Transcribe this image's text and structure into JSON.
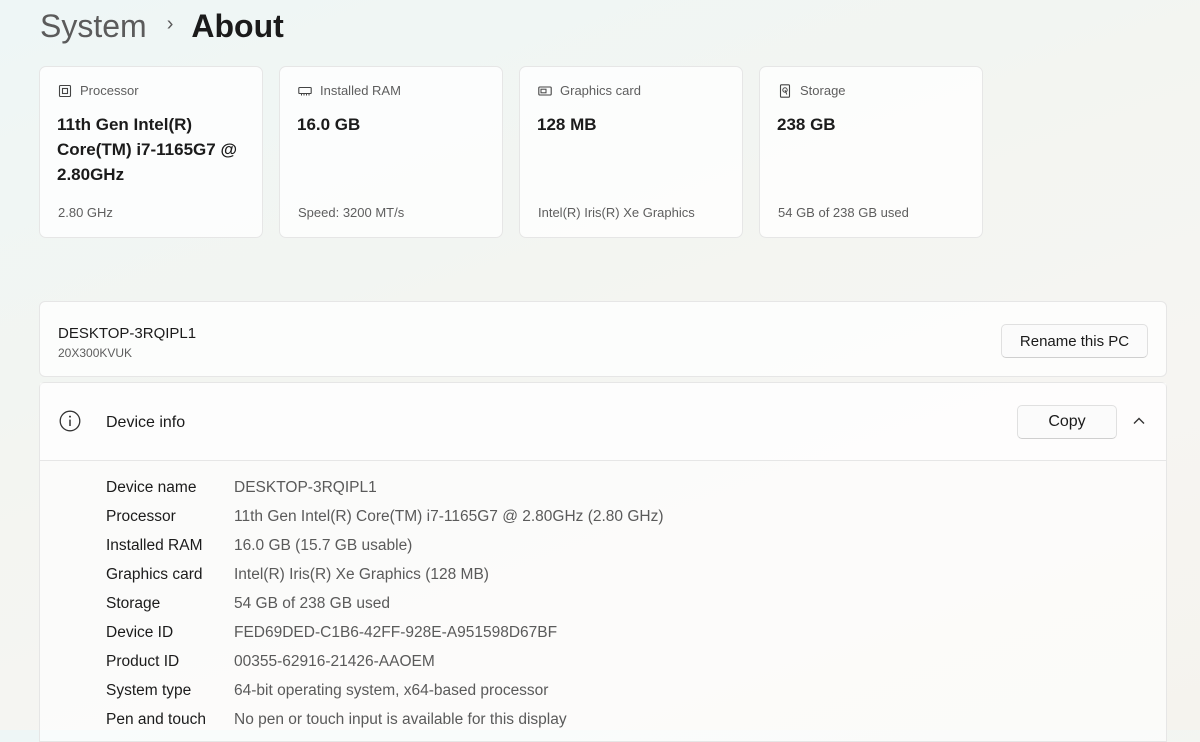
{
  "breadcrumb": {
    "parent": "System",
    "separator": "›",
    "current": "About"
  },
  "spec_cards": [
    {
      "icon": "processor-icon",
      "label": "Processor",
      "value": "11th Gen Intel(R) Core(TM) i7-1165G7 @ 2.80GHz",
      "sub": "2.80 GHz"
    },
    {
      "icon": "ram-icon",
      "label": "Installed RAM",
      "value": "16.0 GB",
      "sub": "Speed: 3200 MT/s"
    },
    {
      "icon": "graphics-card-icon",
      "label": "Graphics card",
      "value": "128 MB",
      "sub": "Intel(R) Iris(R) Xe Graphics"
    },
    {
      "icon": "storage-icon",
      "label": "Storage",
      "value": "238 GB",
      "sub": "54 GB of 238 GB used"
    }
  ],
  "pc": {
    "name": "DESKTOP-3RQIPL1",
    "model": "20X300KVUK",
    "rename_label": "Rename this PC"
  },
  "device_info": {
    "icon": "info-icon",
    "title": "Device info",
    "copy_label": "Copy",
    "rows": [
      {
        "key": "Device name",
        "value": "DESKTOP-3RQIPL1"
      },
      {
        "key": "Processor",
        "value": "11th Gen Intel(R) Core(TM) i7-1165G7 @ 2.80GHz (2.80 GHz)"
      },
      {
        "key": "Installed RAM",
        "value": "16.0 GB (15.7 GB usable)"
      },
      {
        "key": "Graphics card",
        "value": "Intel(R) Iris(R) Xe Graphics (128 MB)"
      },
      {
        "key": "Storage",
        "value": "54 GB of 238 GB used"
      },
      {
        "key": "Device ID",
        "value": "FED69DED-C1B6-42FF-928E-A951598D67BF"
      },
      {
        "key": "Product ID",
        "value": "00355-62916-21426-AAOEM"
      },
      {
        "key": "System type",
        "value": "64-bit operating system, x64-based processor"
      },
      {
        "key": "Pen and touch",
        "value": "No pen or touch input is available for this display"
      }
    ]
  },
  "colors": {
    "text_primary": "#1b1b1b",
    "text_secondary": "#5e5e5e",
    "card_border": "#e6e6e6"
  }
}
